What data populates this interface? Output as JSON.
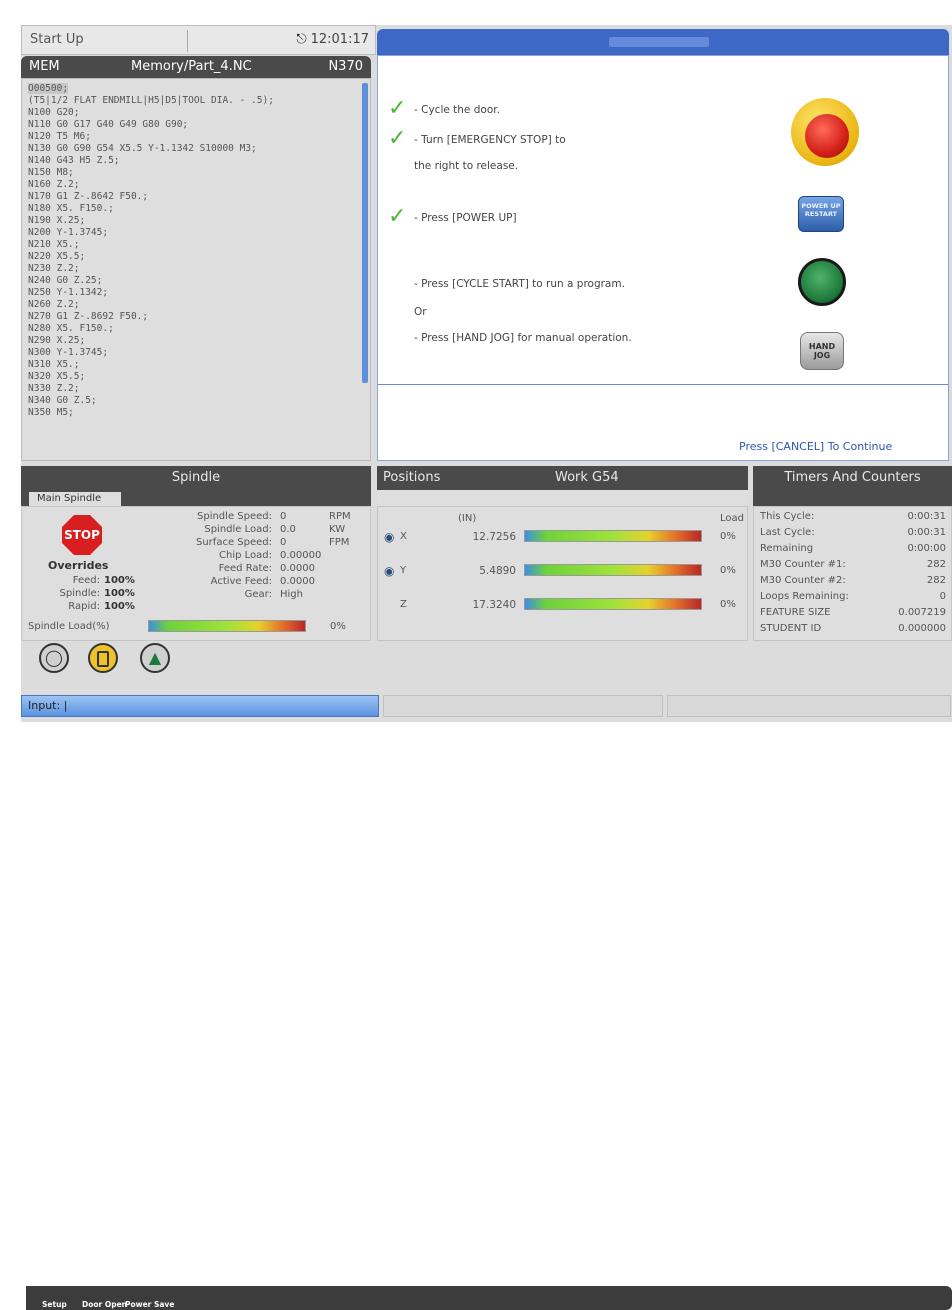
{
  "top_bar": {
    "mode": "Start Up",
    "clock": "12:01:17",
    "clock_icon": "camera-icon"
  },
  "program": {
    "mode": "MEM",
    "path": "Memory/Part_4.NC",
    "line": "N370",
    "code_lines": [
      "O00500;",
      "(T5|1/2 FLAT ENDMILL|H5|D5|TOOL DIA. - .5);",
      "N100 G20;",
      "N110 G0 G17 G40 G49 G80 G90;",
      "N120 T5 M6;",
      "N130 G0 G90 G54 X5.5 Y-1.1342 S10000 M3;",
      "N140 G43 H5 Z.5;",
      "N150 M8;",
      "N160 Z.2;",
      "N170 G1 Z-.8642 F50.;",
      "N180 X5. F150.;",
      "N190 X.25;",
      "N200 Y-1.3745;",
      "N210 X5.;",
      "N220 X5.5;",
      "N230 Z.2;",
      "N240 G0 Z.25;",
      "N250 Y-1.1342;",
      "N260 Z.2;",
      "N270 G1 Z-.8692 F50.;",
      "N280 X5. F150.;",
      "N290 X.25;",
      "N300 Y-1.3745;",
      "N310 X5.;",
      "N320 X5.5;",
      "N330 Z.2;",
      "N340 G0 Z.5;",
      "N350 M5;"
    ]
  },
  "instructions": {
    "step1": "- Cycle the door.",
    "step2a": "- Turn [EMERGENCY STOP] to",
    "step2b": "the right to release.",
    "step3": "- Press [POWER UP]",
    "step4": "- Press [CYCLE START] to run a program.",
    "or": "Or",
    "step5": "- Press [HAND JOG] for manual operation.",
    "cancel": "Press [CANCEL] To Continue",
    "power_button_text": "POWER UP RESTART",
    "jog_button_text": "HAND JOG",
    "check_color": "#4db33a"
  },
  "spindle": {
    "title": "Spindle",
    "tab": "Main Spindle",
    "stop_label": "STOP",
    "overrides_label": "Overrides",
    "overrides": [
      {
        "label": "Feed:",
        "value": "100%"
      },
      {
        "label": "Spindle:",
        "value": "100%"
      },
      {
        "label": "Rapid:",
        "value": "100%"
      }
    ],
    "stats": [
      {
        "label": "Spindle Speed:",
        "value": "0",
        "unit": "RPM"
      },
      {
        "label": "Spindle Load:",
        "value": "0.0",
        "unit": "KW"
      },
      {
        "label": "Surface Speed:",
        "value": "0",
        "unit": "FPM"
      },
      {
        "label": "Chip Load:",
        "value": "0.00000",
        "unit": ""
      },
      {
        "label": "Feed Rate:",
        "value": "0.0000",
        "unit": ""
      },
      {
        "label": "Active Feed:",
        "value": "0.0000",
        "unit": ""
      },
      {
        "label": "Gear:",
        "value": "High",
        "unit": ""
      }
    ],
    "load_label": "Spindle Load(%)",
    "load_value": "0%"
  },
  "positions": {
    "title": "Positions",
    "work": "Work G54",
    "unit": "(IN)",
    "load_header": "Load",
    "axes": [
      {
        "axis": "X",
        "value": "12.7256",
        "load": "0%",
        "icon": "home-icon"
      },
      {
        "axis": "Y",
        "value": "5.4890",
        "load": "0%",
        "icon": "home-icon"
      },
      {
        "axis": "Z",
        "value": "17.3240",
        "load": "0%",
        "icon": ""
      }
    ]
  },
  "timers": {
    "title": "Timers And Counters",
    "rows": [
      {
        "label": "This Cycle:",
        "value": "0:00:31"
      },
      {
        "label": "Last Cycle:",
        "value": "0:00:31"
      },
      {
        "label": "Remaining",
        "value": "0:00:00"
      },
      {
        "label": "M30 Counter #1:",
        "value": "282"
      },
      {
        "label": "M30 Counter #2:",
        "value": "282"
      },
      {
        "label": "Loops Remaining:",
        "value": "0"
      },
      {
        "label": "FEATURE SIZE",
        "value": "0.007219"
      },
      {
        "label": "STUDENT ID",
        "value": "0.000000"
      }
    ]
  },
  "icon_bar": {
    "setup": "Setup",
    "door": "Door Open",
    "power_save": "Power Save"
  },
  "input": {
    "label": "Input:",
    "cursor": "|"
  }
}
